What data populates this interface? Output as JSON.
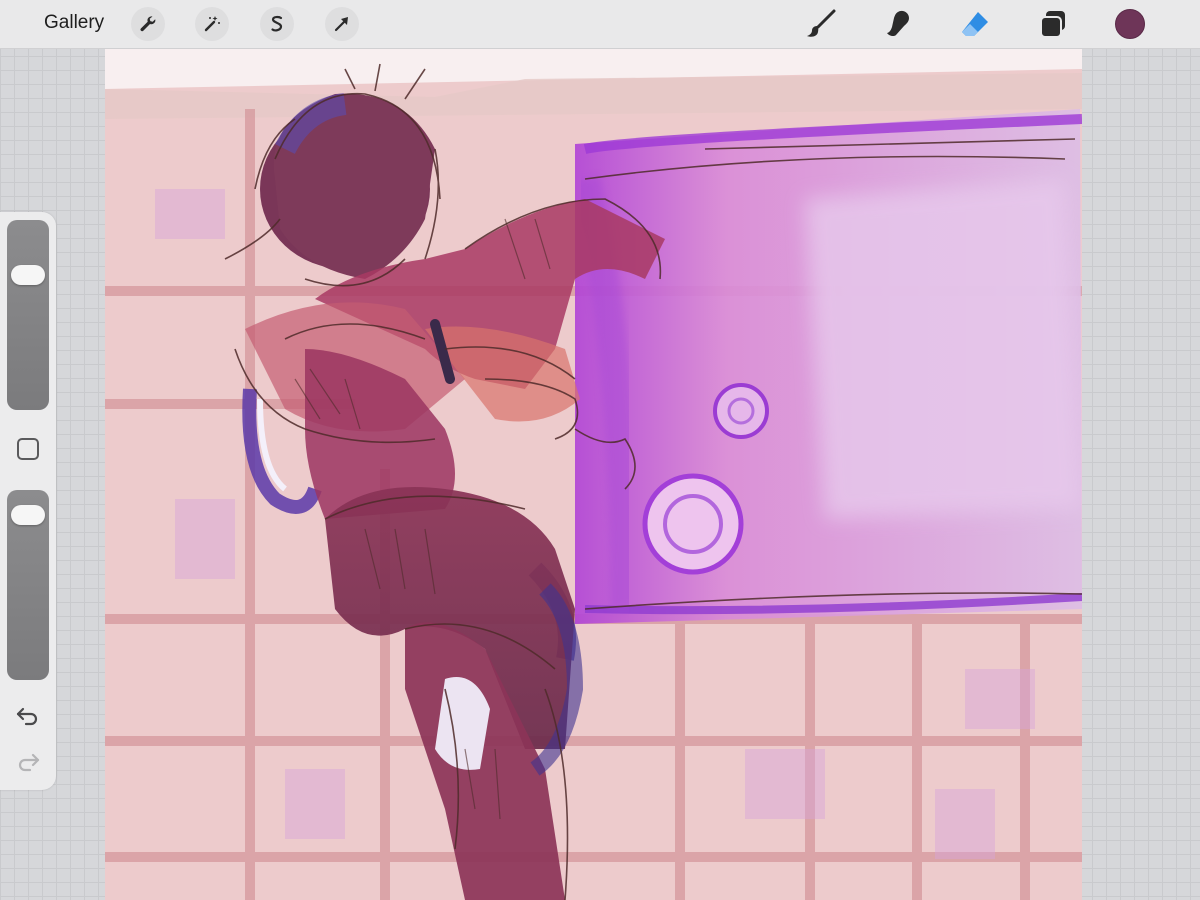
{
  "topbar": {
    "gallery_label": "Gallery",
    "left_tools": [
      {
        "name": "actions",
        "icon": "wrench-icon"
      },
      {
        "name": "adjustments",
        "icon": "magic-wand-icon"
      },
      {
        "name": "selection",
        "icon": "selection-s-icon"
      },
      {
        "name": "transform",
        "icon": "arrow-cursor-icon"
      }
    ],
    "right_tools": [
      {
        "name": "brush",
        "icon": "paintbrush-icon",
        "active": false
      },
      {
        "name": "smudge",
        "icon": "smudge-finger-icon",
        "active": false
      },
      {
        "name": "eraser",
        "icon": "eraser-icon",
        "active": true
      },
      {
        "name": "layers",
        "icon": "layers-icon",
        "active": false
      }
    ],
    "current_color": "#6e3558",
    "active_color": "#2f8de4"
  },
  "sidebar": {
    "brush_size_level": 0.75,
    "opacity_level": 0.93,
    "modify_icon": "square-icon",
    "undo_icon": "undo-arrow-icon",
    "redo_icon": "redo-arrow-icon",
    "redo_enabled": false
  },
  "canvas": {
    "artwork": "sketch-painting",
    "palette": {
      "background": "#ecc8c8",
      "grid": "#d89a9e",
      "board": "#d8a7dc",
      "board_accent": "#a23ad6",
      "figure": "#7e2f52",
      "figure_shadow": "#4a2a7a",
      "line": "#4f2b2a"
    }
  }
}
